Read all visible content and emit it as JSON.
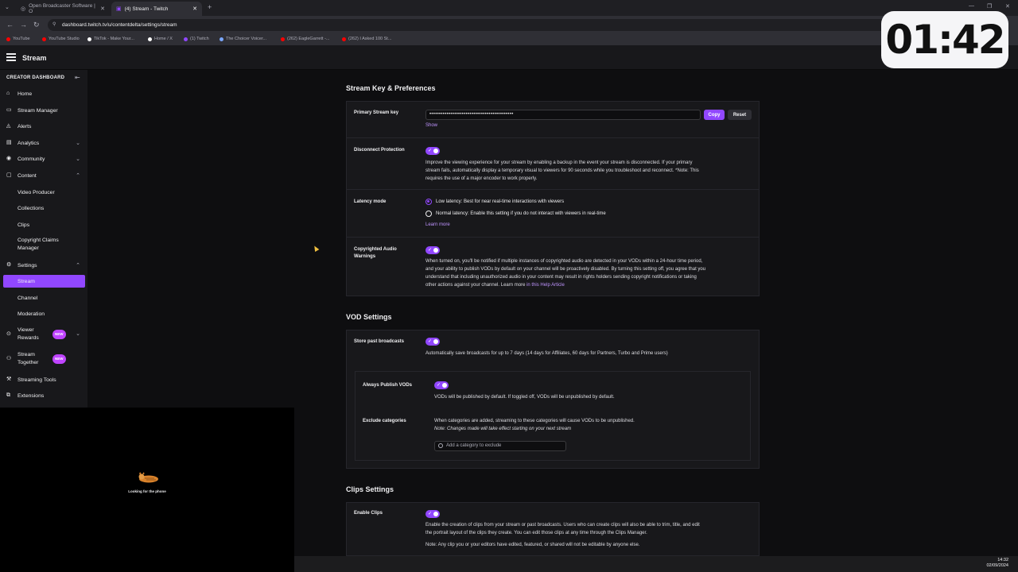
{
  "browser": {
    "tabs": [
      {
        "title": "Open Broadcaster Software | O",
        "active": false
      },
      {
        "title": "(4) Stream - Twitch",
        "active": true
      }
    ],
    "url": "dashboard.twitch.tv/u/contentdelta/settings/stream",
    "bookmarks": [
      {
        "label": "YouTube",
        "color": "#ff0000"
      },
      {
        "label": "YouTube Studio",
        "color": "#ff0000"
      },
      {
        "label": "TikTok - Make Your...",
        "color": "#ffffff"
      },
      {
        "label": "Home / X",
        "color": "#ffffff"
      },
      {
        "label": "(1) Twitch",
        "color": "#9147ff"
      },
      {
        "label": "The Choicer Voicer...",
        "color": "#7aa7ff"
      },
      {
        "label": "(262) EagleGarrett -...",
        "color": "#ff0000"
      },
      {
        "label": "(262) I Asked 100 St...",
        "color": "#ff0000"
      }
    ]
  },
  "header": {
    "title": "Stream"
  },
  "overlay_timer": "01:42",
  "sidebar": {
    "heading": "CREATOR DASHBOARD",
    "items": [
      {
        "label": "Home",
        "icon": "home-icon"
      },
      {
        "label": "Stream Manager",
        "icon": "stream-manager-icon"
      },
      {
        "label": "Alerts",
        "icon": "bell-icon"
      },
      {
        "label": "Analytics",
        "icon": "analytics-icon",
        "chevron": "down"
      },
      {
        "label": "Community",
        "icon": "community-icon",
        "chevron": "down"
      },
      {
        "label": "Content",
        "icon": "content-icon",
        "chevron": "up"
      },
      {
        "label": "Video Producer",
        "sub": true
      },
      {
        "label": "Collections",
        "sub": true
      },
      {
        "label": "Clips",
        "sub": true
      },
      {
        "label": "Copyright Claims Manager",
        "sub": true
      },
      {
        "label": "Settings",
        "icon": "gear-icon",
        "chevron": "up"
      },
      {
        "label": "Stream",
        "sub": true,
        "active": true
      },
      {
        "label": "Channel",
        "sub": true
      },
      {
        "label": "Moderation",
        "sub": true
      },
      {
        "label": "Viewer Rewards",
        "icon": "rewards-icon",
        "badge": "NEW",
        "chevron": "down"
      },
      {
        "label": "Stream Together",
        "icon": "stream-together-icon",
        "badge": "NEW"
      },
      {
        "label": "Streaming Tools",
        "icon": "tools-icon"
      },
      {
        "label": "Extensions",
        "icon": "extensions-icon"
      }
    ]
  },
  "webcam": {
    "caption": "Looking for the phone"
  },
  "stream_key_section": {
    "title": "Stream Key & Preferences",
    "primary_key_label": "Primary Stream key",
    "primary_key_value": "••••••••••••••••••••••••••••••••••••••••••••",
    "show_label": "Show",
    "copy_label": "Copy",
    "reset_label": "Reset",
    "disconnect_label": "Disconnect Protection",
    "disconnect_text_1": "Improve the viewing experience for your stream by enabling a backup in the event your stream is disconnected. If your primary",
    "disconnect_text_2": "stream fails, automatically display a temporary visual to viewers for 90 seconds while you troubleshoot and reconnect. *Note: This",
    "disconnect_text_3": "requires the use of a major encoder to work properly.",
    "latency_label": "Latency mode",
    "latency_low": "Low latency: Best for near real-time interactions with viewers",
    "latency_normal": "Normal latency: Enable this setting if you do not interact with viewers in real-time",
    "learn_more": "Learn more",
    "copyright_label": "Copyrighted Audio Warnings",
    "copyright_text_1": "When turned on, you'll be notified if multiple instances of copyrighted audio are detected in your VODs within a 24-hour time period,",
    "copyright_text_2": "and your ability to publish VODs by default on your channel will be proactively disabled. By turning this setting off, you agree that you",
    "copyright_text_3": "understand that including unauthorized audio in your content may result in rights holders sending copyright notifications or taking",
    "copyright_text_4": "other actions against your channel. Learn more",
    "copyright_link": "in this Help Article"
  },
  "vod_section": {
    "title": "VOD Settings",
    "store_label": "Store past broadcasts",
    "store_text": "Automatically save broadcasts for up to 7 days (14 days for Affiliates, 60 days for Partners, Turbo and Prime users)",
    "always_publish_label": "Always Publish VODs",
    "always_publish_text": "VODs will be published by default. If toggled off, VODs will be unpublished by default.",
    "exclude_label": "Exclude categories",
    "exclude_text": "When categories are added, streaming to these categories will cause VODs to be unpublished.",
    "exclude_note": "Note: Changes made will take effect starting on your next stream",
    "exclude_placeholder": "Add a category to exclude"
  },
  "clips_section": {
    "title": "Clips Settings",
    "enable_label": "Enable Clips",
    "enable_text_1": "Enable the creation of clips from your stream or past broadcasts. Users who can create clips will also be able to trim, title, and edit",
    "enable_text_2": "the portrait layout of the clips they create. You can edit those clips at any time through the Clips Manager.",
    "enable_note": "Note: Any clip you or your editors have edited, featured, or shared will not be editable by anyone else."
  },
  "taskbar": {
    "time": "14:32",
    "date": "02/09/2024"
  }
}
